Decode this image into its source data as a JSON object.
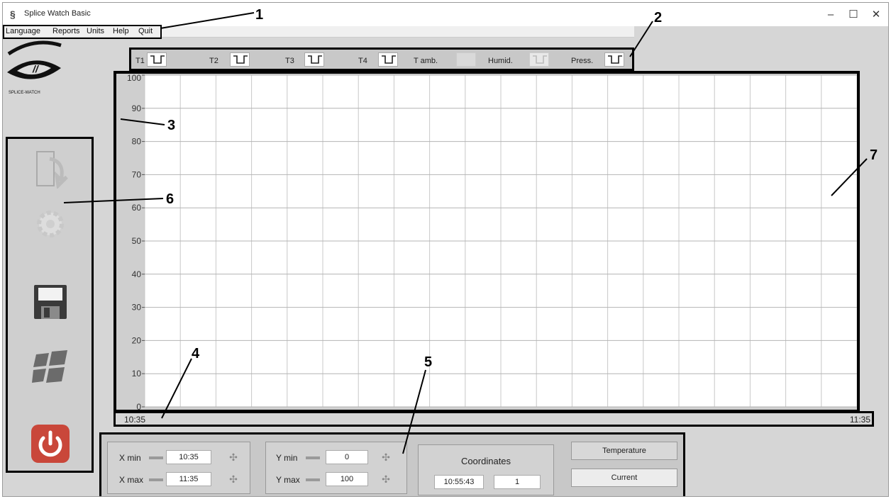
{
  "window": {
    "title": "Splice Watch Basic",
    "controls": [
      "–",
      "☐",
      "✕"
    ]
  },
  "menu": {
    "items": [
      "Language",
      "Reports",
      "Units",
      "Help",
      "Quit"
    ]
  },
  "logo_text": "SPLICE-WATCH",
  "sensors": [
    {
      "label": "T1"
    },
    {
      "label": "T2"
    },
    {
      "label": "T3"
    },
    {
      "label": "T4"
    },
    {
      "label": "T amb."
    },
    {
      "label": "Humid."
    },
    {
      "label": "Press."
    }
  ],
  "chart_data": {
    "type": "line",
    "y_ticks": [
      "0",
      "10",
      "20",
      "30",
      "40",
      "50",
      "60",
      "70",
      "80",
      "90",
      "100"
    ],
    "ylim": [
      0,
      100
    ],
    "x_start": "10:35",
    "x_end": "11:35",
    "cursor_time": "10:55:43",
    "grid": true,
    "series": []
  },
  "controls": {
    "xmin_label": "X min",
    "xmin_value": "10:35",
    "xmax_label": "X max",
    "xmax_value": "11:35",
    "ymin_label": "Y min",
    "ymin_value": "0",
    "ymax_label": "Y max",
    "ymax_value": "100",
    "coords_title": "Coordinates",
    "coord_x": "10:55:43",
    "coord_y": "1",
    "temperature_btn": "Temperature",
    "current_btn": "Current"
  },
  "callouts": [
    "1",
    "2",
    "3",
    "4",
    "5",
    "6",
    "7"
  ]
}
